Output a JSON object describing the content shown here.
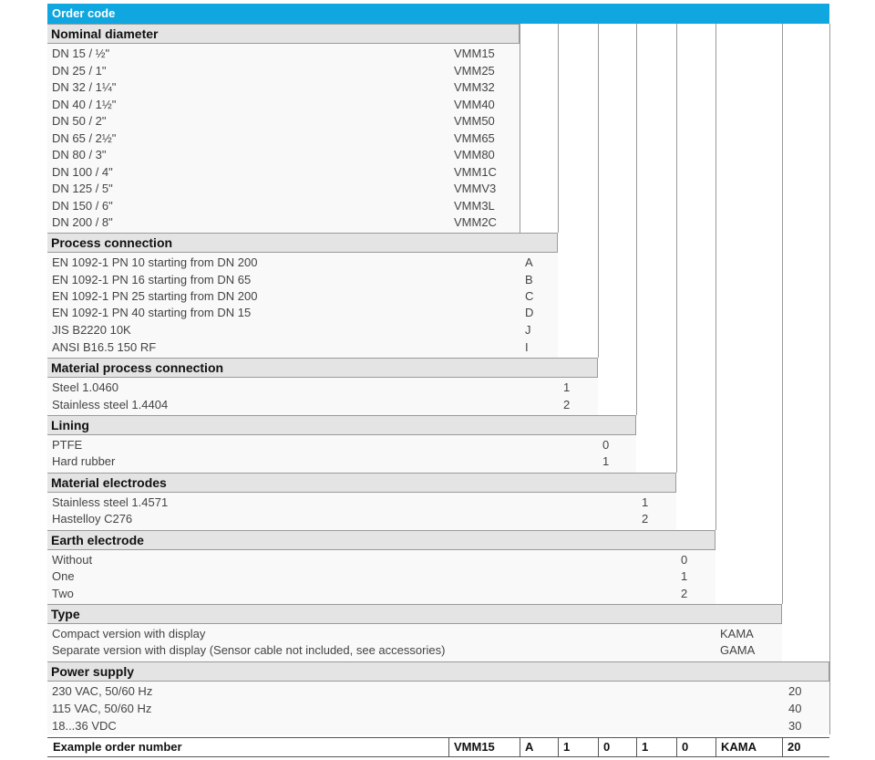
{
  "title": "Order code",
  "sections": [
    {
      "heading": "Nominal diameter",
      "options": [
        {
          "label": "DN 15 / ½\"",
          "code": "VMM15"
        },
        {
          "label": "DN 25 / 1\"",
          "code": "VMM25"
        },
        {
          "label": "DN 32 / 1¼\"",
          "code": "VMM32"
        },
        {
          "label": "DN 40 / 1½\"",
          "code": "VMM40"
        },
        {
          "label": "DN 50 / 2\"",
          "code": "VMM50"
        },
        {
          "label": "DN 65 / 2½\"",
          "code": "VMM65"
        },
        {
          "label": "DN 80 / 3\"",
          "code": "VMM80"
        },
        {
          "label": "DN 100 / 4\"",
          "code": "VMM1C"
        },
        {
          "label": "DN 125 / 5\"",
          "code": "VMMV3"
        },
        {
          "label": "DN 150 / 6\"",
          "code": "VMM3L"
        },
        {
          "label": "DN 200 / 8\"",
          "code": "VMM2C"
        }
      ]
    },
    {
      "heading": "Process connection",
      "options": [
        {
          "label": "EN 1092-1 PN 10 starting from DN 200",
          "code": "A"
        },
        {
          "label": "EN 1092-1 PN 16 starting from DN 65",
          "code": "B"
        },
        {
          "label": "EN 1092-1 PN 25 starting from DN 200",
          "code": "C"
        },
        {
          "label": "EN 1092-1 PN 40 starting from DN 15",
          "code": "D"
        },
        {
          "label": "JIS B2220 10K",
          "code": "J"
        },
        {
          "label": "ANSI B16.5 150 RF",
          "code": "I"
        }
      ]
    },
    {
      "heading": "Material process connection",
      "options": [
        {
          "label": "Steel 1.0460",
          "code": "1"
        },
        {
          "label": "Stainless steel 1.4404",
          "code": "2"
        }
      ]
    },
    {
      "heading": "Lining",
      "options": [
        {
          "label": "PTFE",
          "code": "0"
        },
        {
          "label": "Hard rubber",
          "code": "1"
        }
      ]
    },
    {
      "heading": "Material electrodes",
      "options": [
        {
          "label": "Stainless steel 1.4571",
          "code": "1"
        },
        {
          "label": "Hastelloy C276",
          "code": "2"
        }
      ]
    },
    {
      "heading": "Earth electrode",
      "options": [
        {
          "label": "Without",
          "code": "0"
        },
        {
          "label": "One",
          "code": "1"
        },
        {
          "label": "Two",
          "code": "2"
        }
      ]
    },
    {
      "heading": "Type",
      "options": [
        {
          "label": "Compact version with display",
          "code": "KAMA"
        },
        {
          "label": "Separate version with display (Sensor cable not included, see accessories)",
          "code": "GAMA"
        }
      ]
    },
    {
      "heading": "Power supply",
      "options": [
        {
          "label": "230 VAC, 50/60 Hz",
          "code": "20"
        },
        {
          "label": "115 VAC, 50/60 Hz",
          "code": "40"
        },
        {
          "label": "18...36 VDC",
          "code": "30"
        }
      ]
    }
  ],
  "example": {
    "label": "Example order number",
    "codes": [
      "VMM15",
      "A",
      "1",
      "0",
      "1",
      "0",
      "KAMA",
      "20"
    ]
  },
  "colors": {
    "title_bar": "#10a6e0",
    "section_heading_bg": "#e4e4e4",
    "border": "#9a9a9a"
  }
}
